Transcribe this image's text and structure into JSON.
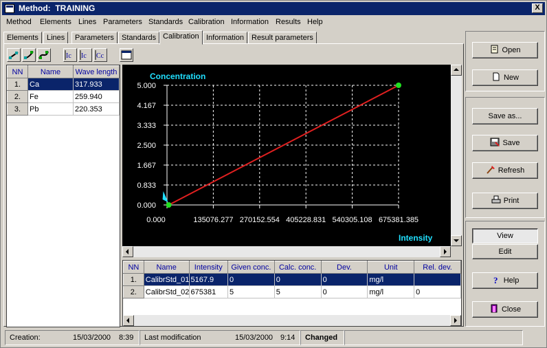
{
  "window": {
    "title": "Method:  TRAINING",
    "close_label": "X"
  },
  "menu": [
    "Method",
    "Elements",
    "Lines",
    "Parameters",
    "Standards",
    "Calibration",
    "Information",
    "Results",
    "Help"
  ],
  "tabs": [
    {
      "label": "Elements"
    },
    {
      "label": "Lines"
    },
    {
      "label": "Parameters"
    },
    {
      "label": "Standards"
    },
    {
      "label": "Calibration",
      "active": true
    },
    {
      "label": "Information"
    },
    {
      "label": "Result parameters"
    }
  ],
  "toolbar_icons": [
    "calib-linear-icon",
    "calib-quadratic-icon",
    "calib-cubic-icon",
    "intensity-correction-icon",
    "overlap-correction-icon",
    "concentration-correction-icon",
    "window-icon"
  ],
  "elements_table": {
    "headers": [
      "NN",
      "Name",
      "Wave length"
    ],
    "rows": [
      {
        "nn": "1.",
        "name": "Ca",
        "wave": "317.933",
        "selected": true
      },
      {
        "nn": "2.",
        "name": "Fe",
        "wave": "259.940"
      },
      {
        "nn": "3.",
        "name": "Pb",
        "wave": "220.353"
      }
    ]
  },
  "chart_data": {
    "type": "line",
    "ylabel": "Concentration",
    "xlabel": "Intensity",
    "y_ticks": [
      "5.000",
      "4.167",
      "3.333",
      "2.500",
      "1.667",
      "0.833",
      "0.000"
    ],
    "x_ticks": [
      "0.000",
      "135076.277",
      "270152.554",
      "405228.831",
      "540305.108",
      "675381.385"
    ],
    "xlim": [
      0,
      675381.385
    ],
    "ylim": [
      0,
      5
    ],
    "grid": true,
    "series": [
      {
        "x": [
          5167.9,
          675381
        ],
        "y": [
          0,
          5
        ],
        "color": "#e02020"
      }
    ],
    "point_color": "#20e020",
    "label_color": "#20e0ff",
    "axis_color": "#ffffff"
  },
  "standards_table": {
    "headers": [
      "NN",
      "Name",
      "Intensity",
      "Given conc.",
      "Calc. conc.",
      "Dev.",
      "Unit",
      "Rel. dev."
    ],
    "rows": [
      {
        "nn": "1.",
        "cells": [
          "CalibrStd_01",
          "5167.9",
          "0",
          "0",
          "0",
          "mg/l",
          ""
        ],
        "selected": true
      },
      {
        "nn": "2.",
        "cells": [
          "CalibrStd_02",
          "675381",
          "5",
          "5",
          "0",
          "mg/l",
          "0"
        ]
      }
    ]
  },
  "buttons": {
    "open": "Open",
    "new": "New",
    "save_as": "Save as...",
    "save": "Save",
    "refresh": "Refresh",
    "print": "Print",
    "view": "View",
    "edit": "Edit",
    "help": "Help",
    "close": "Close"
  },
  "status": {
    "creation_label": "Creation:",
    "creation_date": "15/03/2000",
    "creation_time": "8:39",
    "modified_label": "Last modification",
    "modified_date": "15/03/2000",
    "modified_time": "9:14",
    "state": "Changed"
  }
}
